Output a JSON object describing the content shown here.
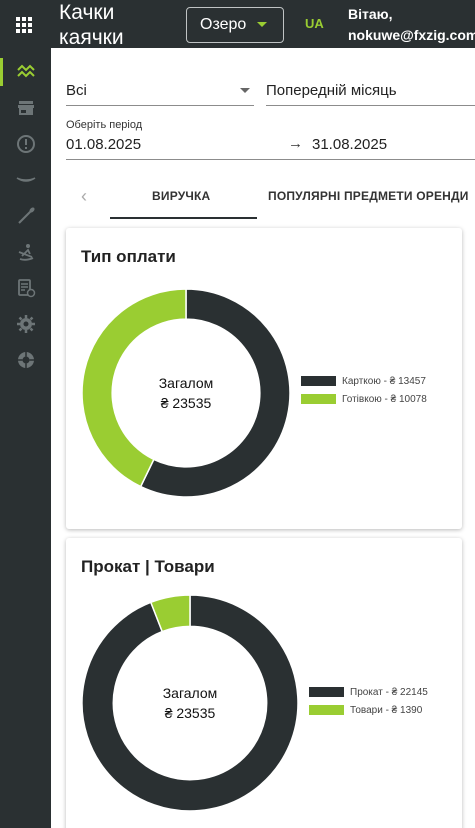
{
  "header": {
    "app_title": "Качки каячки",
    "location": "Озеро",
    "language": "UA",
    "greeting_line1": "Вітаю,",
    "greeting_line2": "nokuwe@fxzig.com"
  },
  "sidebar": {
    "items": [
      {
        "icon": "analytics-icon",
        "active": true
      },
      {
        "icon": "store-icon",
        "active": false
      },
      {
        "icon": "alert-icon",
        "active": false
      },
      {
        "icon": "boat-icon",
        "active": false
      },
      {
        "icon": "paddle-icon",
        "active": false
      },
      {
        "icon": "rower-icon",
        "active": false
      },
      {
        "icon": "schedule-icon",
        "active": false
      },
      {
        "icon": "settings-icon",
        "active": false
      },
      {
        "icon": "support-icon",
        "active": false
      }
    ]
  },
  "filters": {
    "category": "Всі",
    "period_preset": "Попередній місяць",
    "period_label": "Оберіть період",
    "period_start": "01.08.2025",
    "period_arrow": "→",
    "period_end": "31.08.2025"
  },
  "tabs": {
    "prev_icon": "‹",
    "items": [
      "ВИРУЧКА",
      "ПОПУЛЯРНІ ПРЕДМЕТИ ОРЕНДИ"
    ],
    "active_index": 0
  },
  "colors": {
    "dark": "#2a3032",
    "accent": "#9acd32"
  },
  "chart_data": [
    {
      "type": "pie",
      "title": "Тип оплати",
      "center_label": "Загалом",
      "center_value": "₴ 23535",
      "categories": [
        "Карткою - ₴ 13457",
        "Готівкою - ₴ 10078"
      ],
      "values": [
        13457,
        10078
      ],
      "colors": [
        "#2a3032",
        "#9acd32"
      ],
      "legend": "right"
    },
    {
      "type": "pie",
      "title": "Прокат | Товари",
      "center_label": "Загалом",
      "center_value": "₴ 23535",
      "categories": [
        "Прокат - ₴ 22145",
        "Товари - ₴ 1390"
      ],
      "values": [
        22145,
        1390
      ],
      "colors": [
        "#2a3032",
        "#9acd32"
      ],
      "legend": "right"
    }
  ]
}
